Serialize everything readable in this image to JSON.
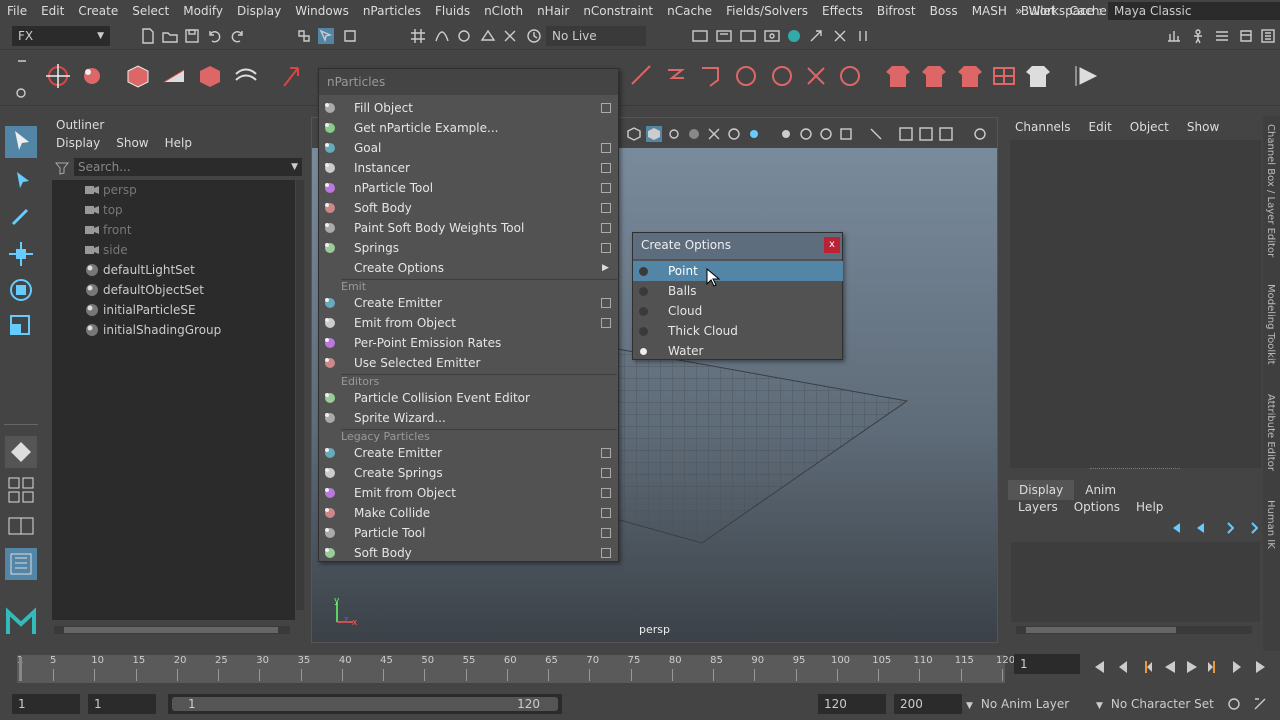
{
  "menubar": [
    "File",
    "Edit",
    "Create",
    "Select",
    "Modify",
    "Display",
    "Windows",
    "nParticles",
    "Fluids",
    "nCloth",
    "nHair",
    "nConstraint",
    "nCache",
    "Fields/Solvers",
    "Effects",
    "Bifrost",
    "Boss",
    "MASH",
    "Bullet",
    "Cache"
  ],
  "workspace": {
    "label": "Workspace :",
    "value": "Maya Classic",
    "more": "»"
  },
  "status": {
    "menuset": "FX",
    "live_surface": "No Live Surface"
  },
  "outliner": {
    "title": "Outliner",
    "menu": [
      "Display",
      "Show",
      "Help"
    ],
    "search_placeholder": "Search...",
    "items": [
      {
        "label": "persp",
        "type": "camera",
        "dim": true
      },
      {
        "label": "top",
        "type": "camera",
        "dim": true
      },
      {
        "label": "front",
        "type": "camera",
        "dim": true
      },
      {
        "label": "side",
        "type": "camera",
        "dim": true
      },
      {
        "label": "defaultLightSet",
        "type": "set",
        "dim": false
      },
      {
        "label": "defaultObjectSet",
        "type": "set",
        "dim": false
      },
      {
        "label": "initialParticleSE",
        "type": "set",
        "dim": false
      },
      {
        "label": "initialShadingGroup",
        "type": "set",
        "dim": false
      }
    ]
  },
  "viewport": {
    "camera_label": "persp",
    "axis_y": "y",
    "axis_x": "x",
    "axis_z": "z"
  },
  "nparticles_menu": {
    "title": "nParticles",
    "rows": [
      {
        "kind": "item",
        "label": "Fill Object",
        "option": true
      },
      {
        "kind": "item",
        "label": "Get nParticle Example...",
        "option": false
      },
      {
        "kind": "item",
        "label": "Goal",
        "option": true
      },
      {
        "kind": "item",
        "label": "Instancer",
        "option": true
      },
      {
        "kind": "item",
        "label": "nParticle Tool",
        "option": true
      },
      {
        "kind": "item",
        "label": "Soft Body",
        "option": true
      },
      {
        "kind": "item",
        "label": "Paint Soft Body Weights Tool",
        "option": true
      },
      {
        "kind": "item",
        "label": "Springs",
        "option": true
      },
      {
        "kind": "submenu",
        "label": "Create Options"
      },
      {
        "kind": "section",
        "label": "Emit"
      },
      {
        "kind": "item",
        "label": "Create Emitter",
        "option": true
      },
      {
        "kind": "item",
        "label": "Emit from Object",
        "option": true
      },
      {
        "kind": "item",
        "label": "Per-Point Emission Rates",
        "option": false
      },
      {
        "kind": "item",
        "label": "Use Selected Emitter",
        "option": false
      },
      {
        "kind": "section",
        "label": "Editors"
      },
      {
        "kind": "item",
        "label": "Particle Collision Event Editor",
        "option": false
      },
      {
        "kind": "item",
        "label": "Sprite Wizard...",
        "option": false
      },
      {
        "kind": "section",
        "label": "Legacy Particles"
      },
      {
        "kind": "item",
        "label": "Create Emitter",
        "option": true
      },
      {
        "kind": "item",
        "label": "Create Springs",
        "option": true
      },
      {
        "kind": "item",
        "label": "Emit from Object",
        "option": true
      },
      {
        "kind": "item",
        "label": "Make Collide",
        "option": true
      },
      {
        "kind": "item",
        "label": "Particle Tool",
        "option": true
      },
      {
        "kind": "item",
        "label": "Soft Body",
        "option": true
      }
    ]
  },
  "create_options": {
    "title": "Create Options",
    "close": "x",
    "items": [
      {
        "label": "Point",
        "selected": false,
        "highlighted": true
      },
      {
        "label": "Balls",
        "selected": false,
        "highlighted": false
      },
      {
        "label": "Cloud",
        "selected": false,
        "highlighted": false
      },
      {
        "label": "Thick Cloud",
        "selected": false,
        "highlighted": false
      },
      {
        "label": "Water",
        "selected": true,
        "highlighted": false
      }
    ]
  },
  "channel_box": {
    "menu": [
      "Channels",
      "Edit",
      "Object",
      "Show"
    ]
  },
  "layer_editor": {
    "tabs": [
      "Display",
      "Anim"
    ],
    "active_tab": "Display",
    "menu": [
      "Layers",
      "Options",
      "Help"
    ]
  },
  "side_tabs": [
    "Channel Box / Layer Editor",
    "Modeling Toolkit",
    "Attribute Editor",
    "Human IK"
  ],
  "timeline": {
    "ticks": [
      1,
      5,
      10,
      15,
      20,
      25,
      30,
      35,
      40,
      45,
      50,
      55,
      60,
      65,
      70,
      75,
      80,
      85,
      90,
      95,
      100,
      105,
      110,
      115,
      120
    ],
    "start": 1,
    "end": 120,
    "current_frame": "1"
  },
  "range": {
    "start_time": "1",
    "playback_start": "1",
    "slider_start": "1",
    "slider_end": "120",
    "playback_end": "120",
    "end_time": "200",
    "anim_layer": "No Anim Layer",
    "character_set": "No Character Set"
  },
  "colors": {
    "accent": "#5285a6",
    "panel": "#444444",
    "field": "#2b2b2b",
    "menu_bg": "#525252",
    "close": "#bb2233"
  }
}
